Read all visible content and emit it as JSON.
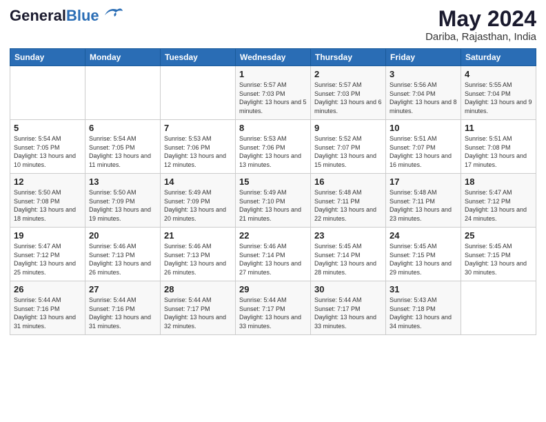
{
  "header": {
    "logo_general": "General",
    "logo_blue": "Blue",
    "month_year": "May 2024",
    "location": "Dariba, Rajasthan, India"
  },
  "weekdays": [
    "Sunday",
    "Monday",
    "Tuesday",
    "Wednesday",
    "Thursday",
    "Friday",
    "Saturday"
  ],
  "weeks": [
    [
      {
        "day": "",
        "sunrise": "",
        "sunset": "",
        "daylight": ""
      },
      {
        "day": "",
        "sunrise": "",
        "sunset": "",
        "daylight": ""
      },
      {
        "day": "",
        "sunrise": "",
        "sunset": "",
        "daylight": ""
      },
      {
        "day": "1",
        "sunrise": "Sunrise: 5:57 AM",
        "sunset": "Sunset: 7:03 PM",
        "daylight": "Daylight: 13 hours and 5 minutes."
      },
      {
        "day": "2",
        "sunrise": "Sunrise: 5:57 AM",
        "sunset": "Sunset: 7:03 PM",
        "daylight": "Daylight: 13 hours and 6 minutes."
      },
      {
        "day": "3",
        "sunrise": "Sunrise: 5:56 AM",
        "sunset": "Sunset: 7:04 PM",
        "daylight": "Daylight: 13 hours and 8 minutes."
      },
      {
        "day": "4",
        "sunrise": "Sunrise: 5:55 AM",
        "sunset": "Sunset: 7:04 PM",
        "daylight": "Daylight: 13 hours and 9 minutes."
      }
    ],
    [
      {
        "day": "5",
        "sunrise": "Sunrise: 5:54 AM",
        "sunset": "Sunset: 7:05 PM",
        "daylight": "Daylight: 13 hours and 10 minutes."
      },
      {
        "day": "6",
        "sunrise": "Sunrise: 5:54 AM",
        "sunset": "Sunset: 7:05 PM",
        "daylight": "Daylight: 13 hours and 11 minutes."
      },
      {
        "day": "7",
        "sunrise": "Sunrise: 5:53 AM",
        "sunset": "Sunset: 7:06 PM",
        "daylight": "Daylight: 13 hours and 12 minutes."
      },
      {
        "day": "8",
        "sunrise": "Sunrise: 5:53 AM",
        "sunset": "Sunset: 7:06 PM",
        "daylight": "Daylight: 13 hours and 13 minutes."
      },
      {
        "day": "9",
        "sunrise": "Sunrise: 5:52 AM",
        "sunset": "Sunset: 7:07 PM",
        "daylight": "Daylight: 13 hours and 15 minutes."
      },
      {
        "day": "10",
        "sunrise": "Sunrise: 5:51 AM",
        "sunset": "Sunset: 7:07 PM",
        "daylight": "Daylight: 13 hours and 16 minutes."
      },
      {
        "day": "11",
        "sunrise": "Sunrise: 5:51 AM",
        "sunset": "Sunset: 7:08 PM",
        "daylight": "Daylight: 13 hours and 17 minutes."
      }
    ],
    [
      {
        "day": "12",
        "sunrise": "Sunrise: 5:50 AM",
        "sunset": "Sunset: 7:08 PM",
        "daylight": "Daylight: 13 hours and 18 minutes."
      },
      {
        "day": "13",
        "sunrise": "Sunrise: 5:50 AM",
        "sunset": "Sunset: 7:09 PM",
        "daylight": "Daylight: 13 hours and 19 minutes."
      },
      {
        "day": "14",
        "sunrise": "Sunrise: 5:49 AM",
        "sunset": "Sunset: 7:09 PM",
        "daylight": "Daylight: 13 hours and 20 minutes."
      },
      {
        "day": "15",
        "sunrise": "Sunrise: 5:49 AM",
        "sunset": "Sunset: 7:10 PM",
        "daylight": "Daylight: 13 hours and 21 minutes."
      },
      {
        "day": "16",
        "sunrise": "Sunrise: 5:48 AM",
        "sunset": "Sunset: 7:11 PM",
        "daylight": "Daylight: 13 hours and 22 minutes."
      },
      {
        "day": "17",
        "sunrise": "Sunrise: 5:48 AM",
        "sunset": "Sunset: 7:11 PM",
        "daylight": "Daylight: 13 hours and 23 minutes."
      },
      {
        "day": "18",
        "sunrise": "Sunrise: 5:47 AM",
        "sunset": "Sunset: 7:12 PM",
        "daylight": "Daylight: 13 hours and 24 minutes."
      }
    ],
    [
      {
        "day": "19",
        "sunrise": "Sunrise: 5:47 AM",
        "sunset": "Sunset: 7:12 PM",
        "daylight": "Daylight: 13 hours and 25 minutes."
      },
      {
        "day": "20",
        "sunrise": "Sunrise: 5:46 AM",
        "sunset": "Sunset: 7:13 PM",
        "daylight": "Daylight: 13 hours and 26 minutes."
      },
      {
        "day": "21",
        "sunrise": "Sunrise: 5:46 AM",
        "sunset": "Sunset: 7:13 PM",
        "daylight": "Daylight: 13 hours and 26 minutes."
      },
      {
        "day": "22",
        "sunrise": "Sunrise: 5:46 AM",
        "sunset": "Sunset: 7:14 PM",
        "daylight": "Daylight: 13 hours and 27 minutes."
      },
      {
        "day": "23",
        "sunrise": "Sunrise: 5:45 AM",
        "sunset": "Sunset: 7:14 PM",
        "daylight": "Daylight: 13 hours and 28 minutes."
      },
      {
        "day": "24",
        "sunrise": "Sunrise: 5:45 AM",
        "sunset": "Sunset: 7:15 PM",
        "daylight": "Daylight: 13 hours and 29 minutes."
      },
      {
        "day": "25",
        "sunrise": "Sunrise: 5:45 AM",
        "sunset": "Sunset: 7:15 PM",
        "daylight": "Daylight: 13 hours and 30 minutes."
      }
    ],
    [
      {
        "day": "26",
        "sunrise": "Sunrise: 5:44 AM",
        "sunset": "Sunset: 7:16 PM",
        "daylight": "Daylight: 13 hours and 31 minutes."
      },
      {
        "day": "27",
        "sunrise": "Sunrise: 5:44 AM",
        "sunset": "Sunset: 7:16 PM",
        "daylight": "Daylight: 13 hours and 31 minutes."
      },
      {
        "day": "28",
        "sunrise": "Sunrise: 5:44 AM",
        "sunset": "Sunset: 7:17 PM",
        "daylight": "Daylight: 13 hours and 32 minutes."
      },
      {
        "day": "29",
        "sunrise": "Sunrise: 5:44 AM",
        "sunset": "Sunset: 7:17 PM",
        "daylight": "Daylight: 13 hours and 33 minutes."
      },
      {
        "day": "30",
        "sunrise": "Sunrise: 5:44 AM",
        "sunset": "Sunset: 7:17 PM",
        "daylight": "Daylight: 13 hours and 33 minutes."
      },
      {
        "day": "31",
        "sunrise": "Sunrise: 5:43 AM",
        "sunset": "Sunset: 7:18 PM",
        "daylight": "Daylight: 13 hours and 34 minutes."
      },
      {
        "day": "",
        "sunrise": "",
        "sunset": "",
        "daylight": ""
      }
    ]
  ]
}
